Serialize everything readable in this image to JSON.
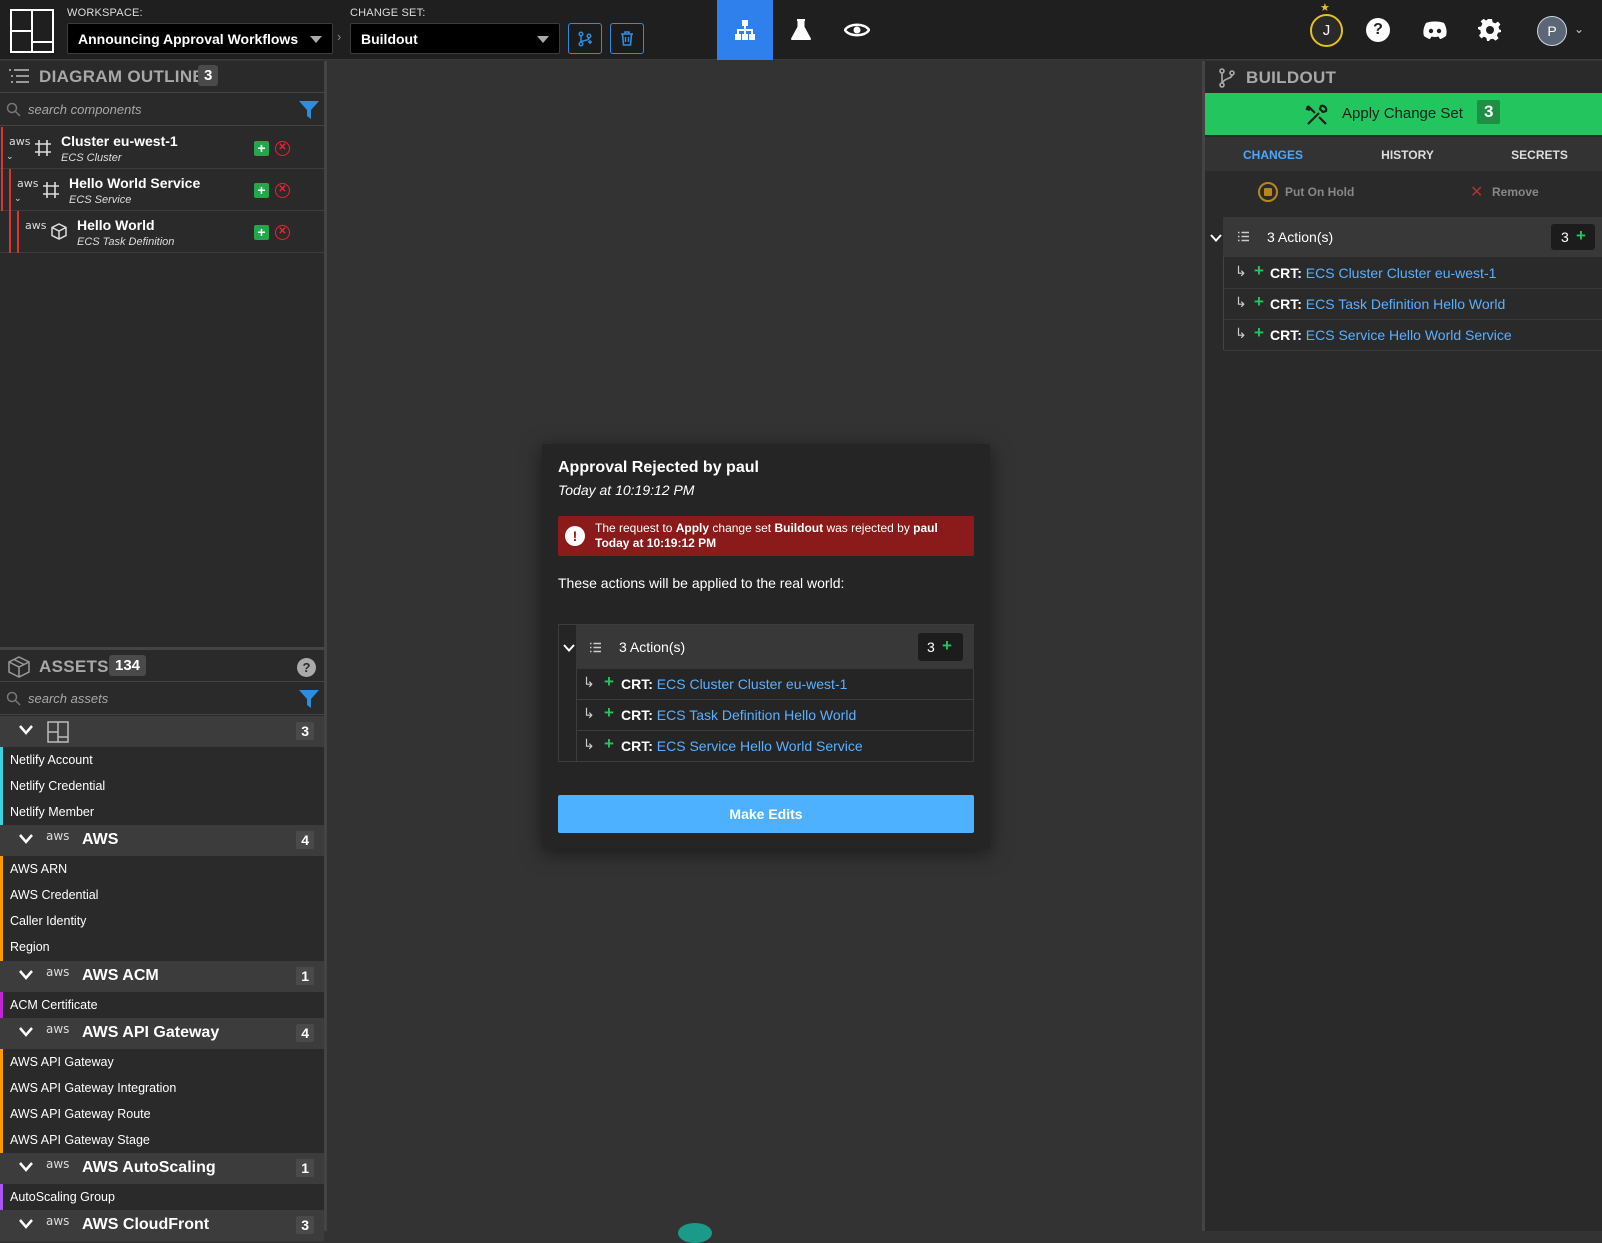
{
  "topbar": {
    "workspace_label": "WORKSPACE:",
    "workspace_value": "Announcing Approval Workflows",
    "changeset_label": "CHANGE SET:",
    "changeset_value": "Buildout",
    "user_initial": "J",
    "profile_initial": "P"
  },
  "outline": {
    "title": "DIAGRAM OUTLINE",
    "count": "3",
    "search_placeholder": "search components",
    "items": [
      {
        "aws": "aws",
        "name": "Cluster eu-west-1",
        "type": "ECS Cluster"
      },
      {
        "aws": "aws",
        "name": "Hello World Service",
        "type": "ECS Service"
      },
      {
        "aws": "aws",
        "name": "Hello World",
        "type": "ECS Task Definition"
      }
    ]
  },
  "assets": {
    "title": "ASSETS",
    "count": "134",
    "search_placeholder": "search assets",
    "categories": [
      {
        "name": "",
        "count": "3",
        "color": "#3fd0e0",
        "items": [
          "Netlify Account",
          "Netlify Credential",
          "Netlify Member"
        ]
      },
      {
        "aws": "aws",
        "name": "AWS",
        "count": "4",
        "color": "#ff9900",
        "items": [
          "AWS ARN",
          "AWS Credential",
          "Caller Identity",
          "Region"
        ]
      },
      {
        "aws": "aws",
        "name": "AWS ACM",
        "count": "1",
        "color": "#c026d3",
        "items": [
          "ACM Certificate"
        ]
      },
      {
        "aws": "aws",
        "name": "AWS API Gateway",
        "count": "4",
        "color": "#ff9900",
        "items": [
          "AWS API Gateway",
          "AWS API Gateway Integration",
          "AWS API Gateway Route",
          "AWS API Gateway Stage"
        ]
      },
      {
        "aws": "aws",
        "name": "AWS AutoScaling",
        "count": "1",
        "color": "#a855f7",
        "items": [
          "AutoScaling Group"
        ]
      },
      {
        "aws": "aws",
        "name": "AWS CloudFront",
        "count": "3",
        "color": "#22c55e",
        "items": []
      }
    ]
  },
  "right": {
    "title": "BUILDOUT",
    "apply_label": "Apply Change Set",
    "apply_count": "3",
    "tabs": [
      "CHANGES",
      "HISTORY",
      "SECRETS"
    ],
    "hold_label": "Put On Hold",
    "remove_label": "Remove",
    "actions_label": "3 Action(s)",
    "actions_count": "3",
    "actions": [
      {
        "kind": "CRT:",
        "text": "ECS Cluster Cluster eu-west-1"
      },
      {
        "kind": "CRT:",
        "text": "ECS Task Definition Hello World"
      },
      {
        "kind": "CRT:",
        "text": "ECS Service Hello World Service"
      }
    ]
  },
  "modal": {
    "title": "Approval Rejected by paul",
    "timestamp": "Today at 10:19:12 PM",
    "alert_prefix": "The request to ",
    "alert_apply": "Apply",
    "alert_mid": " change set ",
    "alert_changeset": "Buildout",
    "alert_mid2": " was rejected by ",
    "alert_user": "paul",
    "alert_time": "Today at 10:19:12 PM",
    "description": "These actions will be applied to the real world:",
    "actions_label": "3 Action(s)",
    "actions_count": "3",
    "actions": [
      {
        "kind": "CRT:",
        "text": "ECS Cluster Cluster eu-west-1"
      },
      {
        "kind": "CRT:",
        "text": "ECS Task Definition Hello World"
      },
      {
        "kind": "CRT:",
        "text": "ECS Service Hello World Service"
      }
    ],
    "button_label": "Make Edits"
  },
  "colors": {
    "accent": "#2f80ed",
    "apply_green": "#22c55e",
    "alert_red": "#8b1a1a",
    "button_blue": "#4db1ff"
  }
}
